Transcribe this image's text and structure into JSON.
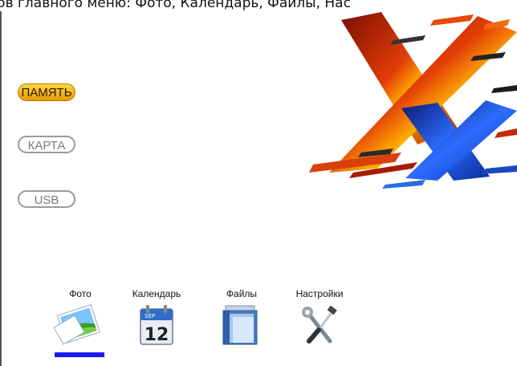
{
  "caption": "ктов главного меню: Фото, Календарь, Файлы, Нас",
  "storage": {
    "memory": "ПАМЯТЬ",
    "card": "КАРТА",
    "usb": "USB",
    "selected": "memory"
  },
  "nav": {
    "photo": "Фото",
    "calendar": "Календарь",
    "files": "Файлы",
    "settings": "Настройки",
    "selected": "photo"
  },
  "calendar_icon": {
    "month": "SEP",
    "day": "12"
  },
  "colors": {
    "active_pill": "#f2b400",
    "selection_underline": "#1a1aff",
    "logo_red": "#d42a08",
    "logo_blue": "#1d3fc0"
  },
  "icons": {
    "photo": "photo-icon",
    "calendar": "calendar-icon",
    "files": "files-icon",
    "settings": "settings-icon",
    "logo": "x-logo"
  }
}
